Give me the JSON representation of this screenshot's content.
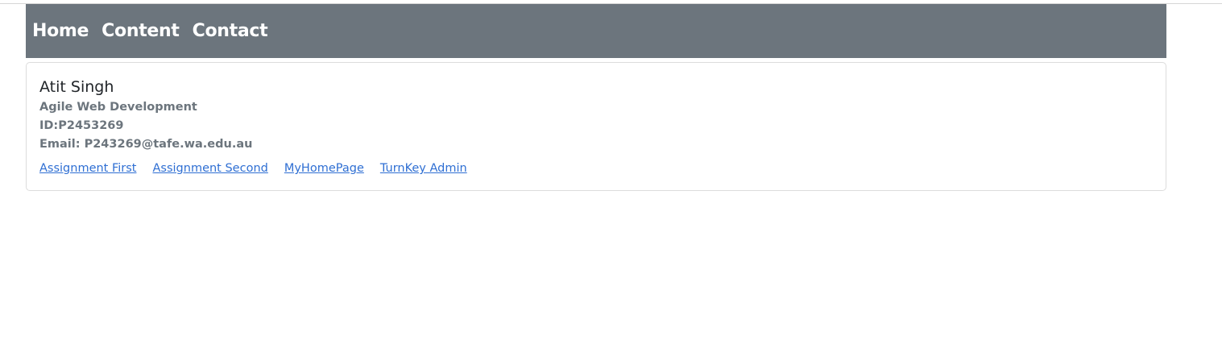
{
  "nav": {
    "items": [
      {
        "label": "Home"
      },
      {
        "label": "Content"
      },
      {
        "label": "Contact"
      }
    ]
  },
  "profile": {
    "name": "Atit Singh",
    "course": "Agile Web Development",
    "id_text": "ID:P2453269",
    "email_text": "Email: P243269@tafe.wa.edu.au"
  },
  "links": [
    {
      "label": "Assignment First"
    },
    {
      "label": "Assignment Second"
    },
    {
      "label": "MyHomePage"
    },
    {
      "label": "TurnKey Admin"
    }
  ],
  "colors": {
    "navbar_bg": "#6c757d",
    "link": "#2f6fd3",
    "muted_text": "#6c757d"
  }
}
